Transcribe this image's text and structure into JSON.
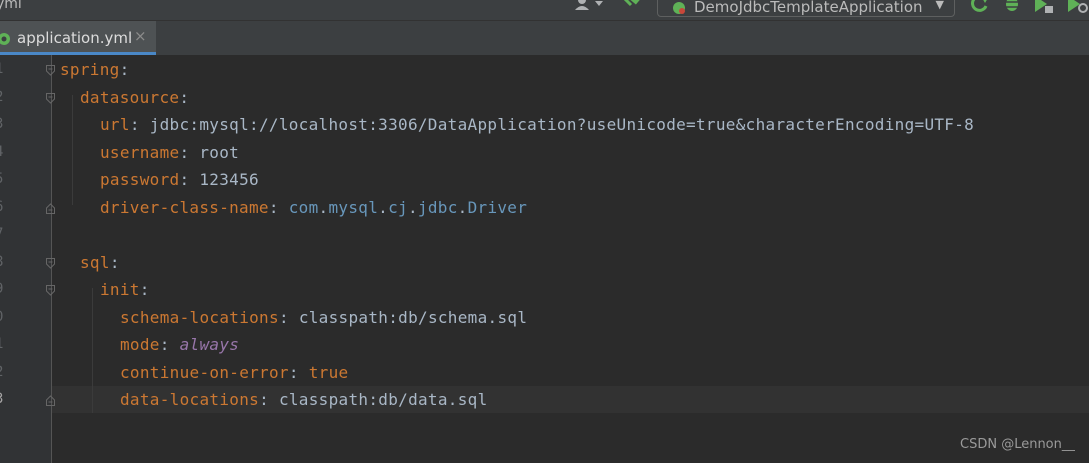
{
  "toolbar": {
    "breadcrumb": "yml",
    "run_config": "DemoJdbcTemplateApplication"
  },
  "tab": {
    "title": "application.yml",
    "close_glyph": "×"
  },
  "editor": {
    "line_numbers": [
      "1",
      "2",
      "3",
      "4",
      "5",
      "6",
      "7",
      "8",
      "9",
      "0",
      "1",
      "2",
      "3"
    ],
    "lines": {
      "spring_key": "spring",
      "datasource_key": "datasource",
      "url_key": "url",
      "url_val": "jdbc:mysql://localhost:3306/DataApplication?useUnicode=true&characterEncoding=UTF-8",
      "username_key": "username",
      "username_val": "root",
      "password_key": "password",
      "password_val": "123456",
      "driver_key": "driver-class-name",
      "driver_val_parts": [
        "com",
        "mysql",
        "cj",
        "jdbc",
        "Driver"
      ],
      "sql_key": "sql",
      "init_key": "init",
      "schema_key": "schema-locations",
      "schema_val": "classpath:db/schema.sql",
      "mode_key": "mode",
      "mode_val": "always",
      "continue_key": "continue-on-error",
      "continue_val": "true",
      "data_key": "data-locations",
      "data_val": "classpath:db/data.sql"
    },
    "colon": ":"
  },
  "watermark": "CSDN @Lennon__",
  "colors": {
    "key": "#cc7832",
    "value": "#a9b7c6",
    "class_ref": "#6897bb",
    "italic_const": "#9876aa",
    "background": "#2b2b2b",
    "tab_underline": "#4a88c7"
  },
  "icons": [
    "user-icon",
    "build-hammer-icon",
    "spring-app-icon",
    "rerun-icon",
    "debug-bug-icon",
    "coverage-icon",
    "profile-icon",
    "yml-file-icon",
    "fold-marker-icon"
  ]
}
